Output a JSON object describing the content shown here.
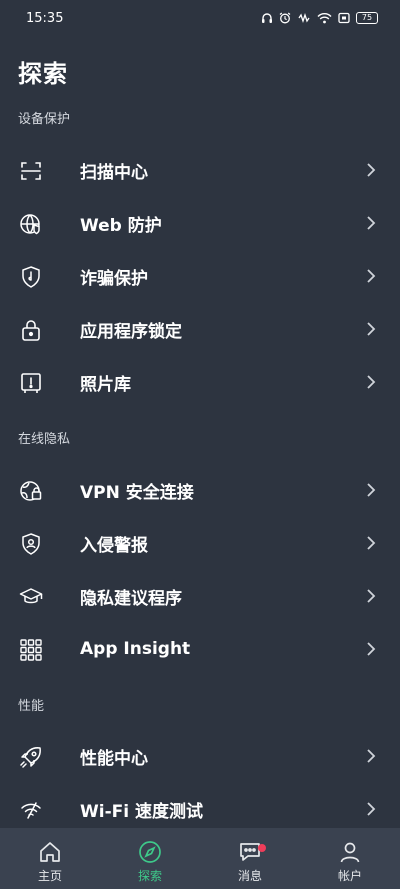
{
  "status_bar": {
    "time": "15:35",
    "battery": "75",
    "icons": [
      "headphones-icon",
      "alarm-icon",
      "vibrate-icon",
      "wifi-icon",
      "screen-icon",
      "battery-icon"
    ]
  },
  "page": {
    "title": "探索"
  },
  "sections": {
    "device": {
      "header": "设备保护"
    },
    "privacy": {
      "header": "在线隐私"
    },
    "performance": {
      "header": "性能"
    }
  },
  "items": {
    "scan": {
      "label": "扫描中心",
      "icon": "scan-icon"
    },
    "web": {
      "label": "Web 防护",
      "icon": "globe-shield-icon"
    },
    "scam": {
      "label": "诈骗保护",
      "icon": "scam-shield-icon"
    },
    "applock": {
      "label": "应用程序锁定",
      "icon": "lock-icon"
    },
    "photo": {
      "label": "照片库",
      "icon": "photo-vault-icon"
    },
    "vpn": {
      "label": "VPN 安全连接",
      "icon": "vpn-icon"
    },
    "intruder": {
      "label": "入侵警报",
      "icon": "intruder-shield-icon"
    },
    "privacy_advisor": {
      "label": "隐私建议程序",
      "icon": "graduation-cap-icon"
    },
    "app_insight": {
      "label": "App Insight",
      "icon": "grid-icon"
    },
    "perf_center": {
      "label": "性能中心",
      "icon": "rocket-icon"
    },
    "wifi_speed": {
      "label": "Wi-Fi 速度测试",
      "icon": "wifi-speed-icon"
    }
  },
  "bottom_nav": {
    "home": "主页",
    "explore": "探索",
    "messages": "消息",
    "account": "帐户"
  },
  "colors": {
    "background": "#2d3440",
    "nav_background": "#3a4250",
    "accent": "#3ec98a",
    "badge": "#ef3d5a"
  }
}
